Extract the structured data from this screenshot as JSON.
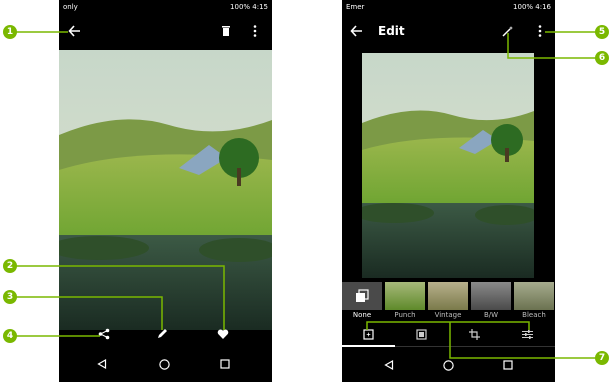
{
  "left_phone": {
    "status_left": "only",
    "status_right": "100% 4:15"
  },
  "right_phone": {
    "status_left": "Emer",
    "status_right": "100% 4:16",
    "title": "Edit",
    "filters": [
      {
        "label": "None",
        "selected": true
      },
      {
        "label": "Punch",
        "selected": false
      },
      {
        "label": "Vintage",
        "selected": false
      },
      {
        "label": "B/W",
        "selected": false
      },
      {
        "label": "Bleach",
        "selected": false
      }
    ]
  },
  "callouts": [
    "1",
    "2",
    "3",
    "4",
    "5",
    "6",
    "7"
  ],
  "colors": {
    "callout": "#7ab800",
    "background": "#000000",
    "text": "#ffffff"
  }
}
